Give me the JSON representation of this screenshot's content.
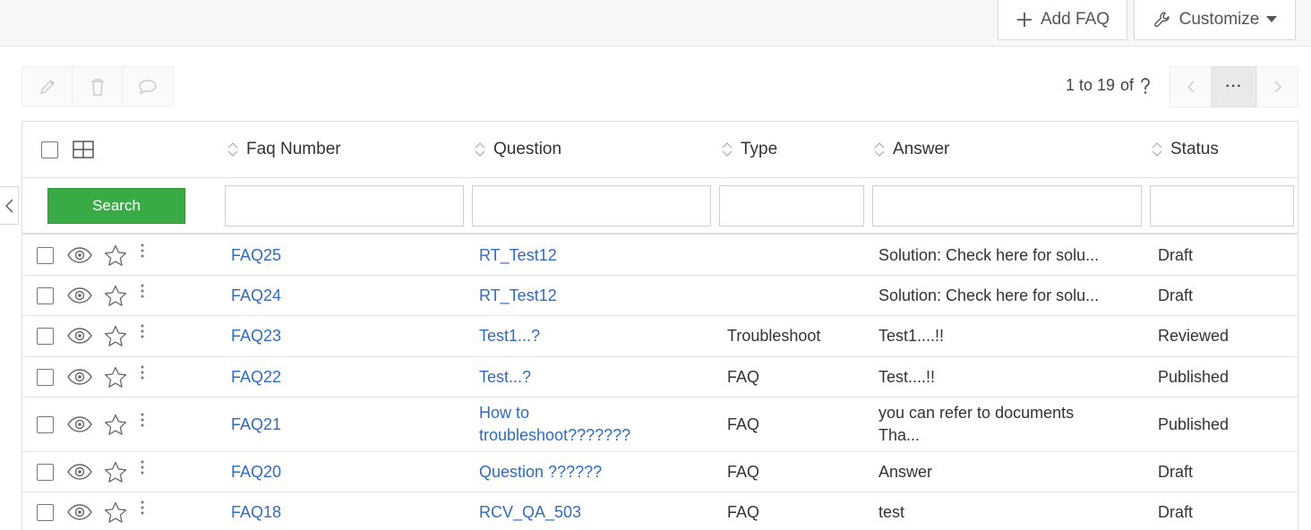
{
  "toolbar": {
    "add_faq_label": "Add FAQ",
    "customize_label": "Customize"
  },
  "pagination": {
    "range_text": "1 to 19",
    "of_text": "of",
    "more_label": "···"
  },
  "columns": {
    "faq_number": "Faq Number",
    "question": "Question",
    "type": "Type",
    "answer": "Answer",
    "status": "Status"
  },
  "filters": {
    "search_label": "Search"
  },
  "rows": [
    {
      "faq": "FAQ25",
      "question": "RT_Test12",
      "type": "",
      "answer": "Solution: Check here for solu...",
      "status": "Draft"
    },
    {
      "faq": "FAQ24",
      "question": "RT_Test12",
      "type": "",
      "answer": "Solution: Check here for solu...",
      "status": "Draft"
    },
    {
      "faq": "FAQ23",
      "question": "Test1...?",
      "type": "Troubleshoot",
      "answer": "Test1....!!",
      "status": "Reviewed"
    },
    {
      "faq": "FAQ22",
      "question": "Test...?",
      "type": "FAQ",
      "answer": "Test....!!",
      "status": "Published"
    },
    {
      "faq": "FAQ21",
      "question_line1": "How to",
      "question_line2": "troubleshoot???????",
      "type": "FAQ",
      "answer_line1": "you can refer to documents",
      "answer_line2": "Tha...",
      "status": "Published"
    },
    {
      "faq": "FAQ20",
      "question": "Question ??????",
      "type": "FAQ",
      "answer": "Answer",
      "status": "Draft"
    },
    {
      "faq": "FAQ18",
      "question": "RCV_QA_503",
      "type": "FAQ",
      "answer": "test",
      "status": "Draft"
    }
  ],
  "colors": {
    "link": "#2f6bc1",
    "search_button": "#3aaa47"
  }
}
